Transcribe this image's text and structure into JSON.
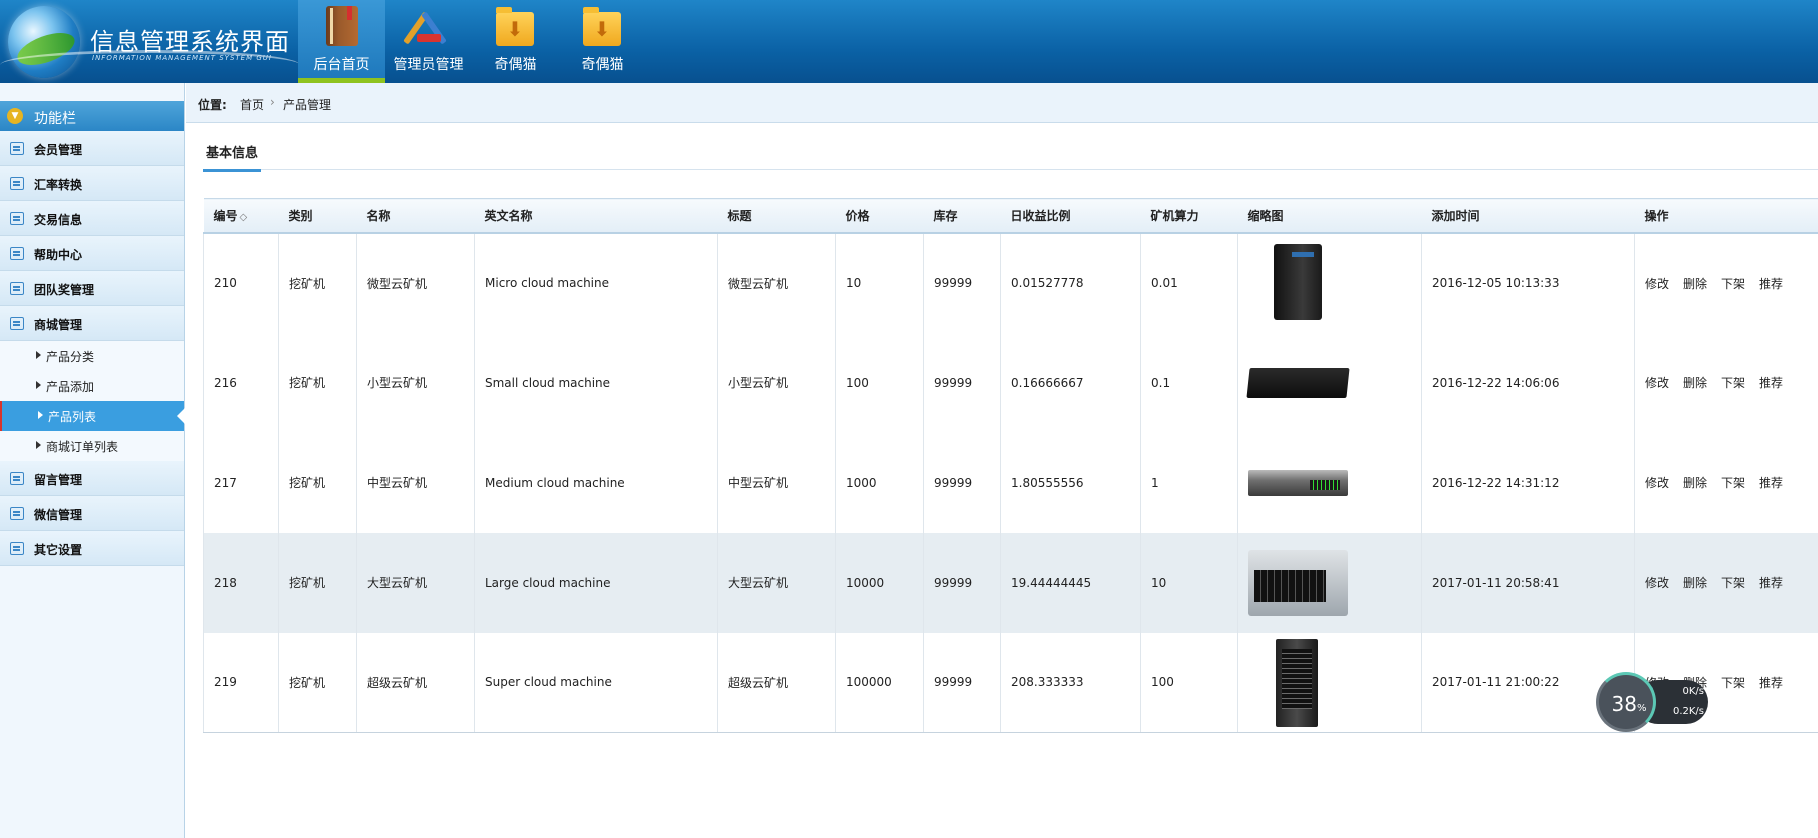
{
  "header": {
    "title": "信息管理系统界面",
    "subtitle": "INFORMATION MANAGEMENT SYSTEM GUI",
    "nav": [
      {
        "label": "后台首页",
        "icon": "book-icon",
        "active": true
      },
      {
        "label": "管理员管理",
        "icon": "tools-icon",
        "active": false
      },
      {
        "label": "奇偶猫",
        "icon": "folder-download-icon",
        "active": false
      },
      {
        "label": "奇偶猫",
        "icon": "folder-download-icon",
        "active": false
      }
    ]
  },
  "sidebar": {
    "heading": "功能栏",
    "items": [
      {
        "label": "会员管理"
      },
      {
        "label": "汇率转换"
      },
      {
        "label": "交易信息"
      },
      {
        "label": "帮助中心"
      },
      {
        "label": "团队奖管理"
      },
      {
        "label": "商城管理"
      }
    ],
    "subitems": [
      {
        "label": "产品分类"
      },
      {
        "label": "产品添加"
      },
      {
        "label": "产品列表",
        "active": true
      },
      {
        "label": "商城订单列表"
      }
    ],
    "items_after": [
      {
        "label": "留言管理"
      },
      {
        "label": "微信管理"
      },
      {
        "label": "其它设置"
      }
    ]
  },
  "breadcrumb": {
    "label": "位置:",
    "home": "首页",
    "separator": "›",
    "current": "产品管理"
  },
  "tabs": {
    "basic": "基本信息"
  },
  "table": {
    "headers": [
      "编号",
      "类别",
      "名称",
      "英文名称",
      "标题",
      "价格",
      "库存",
      "日收益比例",
      "矿机算力",
      "缩略图",
      "添加时间",
      "操作"
    ],
    "sort_mark": "◇",
    "actions": [
      "修改",
      "删除",
      "下架",
      "推荐"
    ],
    "rows": [
      {
        "id": "210",
        "category": "挖矿机",
        "name": "微型云矿机",
        "en_name": "Micro cloud machine",
        "title": "微型云矿机",
        "price": "10",
        "stock": "99999",
        "daily_ratio": "0.01527778",
        "hashrate": "0.01",
        "thumb": "micro-server-icon",
        "added": "2016-12-05 10:13:33"
      },
      {
        "id": "216",
        "category": "挖矿机",
        "name": "小型云矿机",
        "en_name": "Small cloud machine",
        "title": "小型云矿机",
        "price": "100",
        "stock": "99999",
        "daily_ratio": "0.16666667",
        "hashrate": "0.1",
        "thumb": "small-server-icon",
        "added": "2016-12-22 14:06:06"
      },
      {
        "id": "217",
        "category": "挖矿机",
        "name": "中型云矿机",
        "en_name": "Medium cloud machine",
        "title": "中型云矿机",
        "price": "1000",
        "stock": "99999",
        "daily_ratio": "1.80555556",
        "hashrate": "1",
        "thumb": "medium-server-icon",
        "added": "2016-12-22 14:31:12"
      },
      {
        "id": "218",
        "category": "挖矿机",
        "name": "大型云矿机",
        "en_name": "Large cloud machine",
        "title": "大型云矿机",
        "price": "10000",
        "stock": "99999",
        "daily_ratio": "19.44444445",
        "hashrate": "10",
        "thumb": "large-server-icon",
        "added": "2017-01-11 20:58:41",
        "highlighted": true
      },
      {
        "id": "219",
        "category": "挖矿机",
        "name": "超级云矿机",
        "en_name": "Super cloud machine",
        "title": "超级云矿机",
        "price": "100000",
        "stock": "99999",
        "daily_ratio": "208.333333",
        "hashrate": "100",
        "thumb": "super-server-icon",
        "added": "2017-01-11 21:00:22"
      }
    ]
  },
  "speed_widget": {
    "percent": "38",
    "percent_unit": "%",
    "upload": "0K/s",
    "download": "0.2K/s"
  },
  "colors": {
    "header": "#0b62a6",
    "accent": "#3a9ee0",
    "active_underline": "#8fc31f"
  }
}
